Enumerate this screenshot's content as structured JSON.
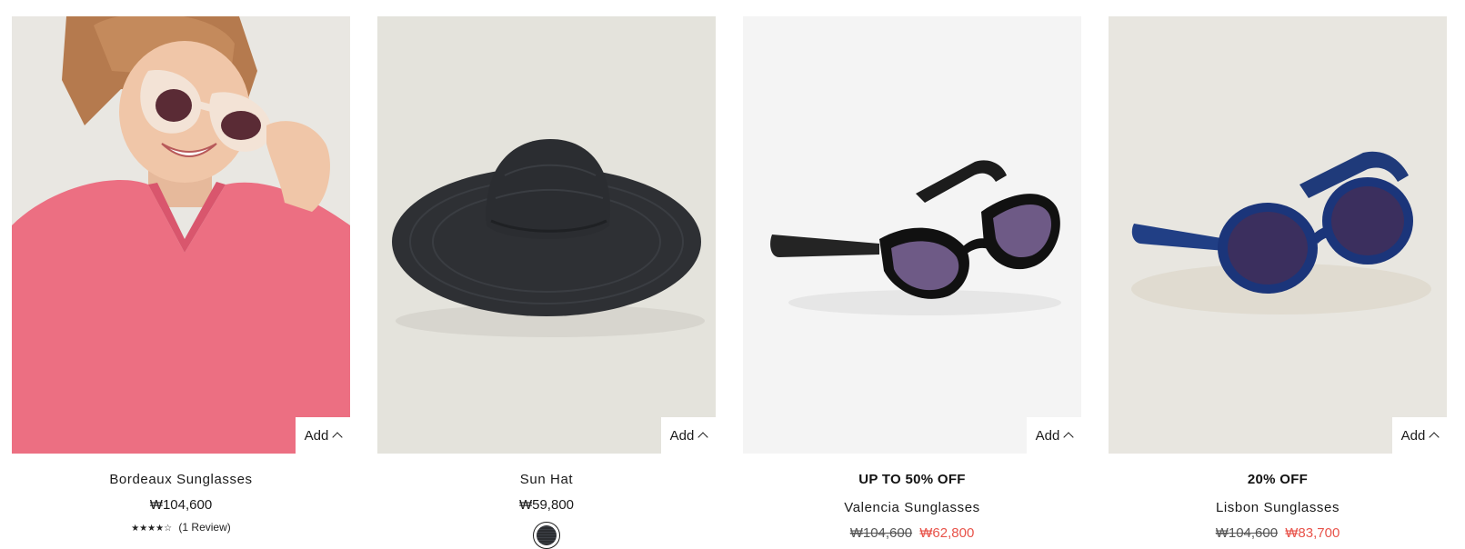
{
  "add_label": "Add",
  "colors": {
    "sale": "#e8534a",
    "text": "#1a1a1a"
  },
  "products": [
    {
      "name": "Bordeaux Sunglasses",
      "price": "₩104,600",
      "rating_stars": "★★★★☆",
      "rating": 4,
      "reviews": "(1 Review)",
      "image": "woman-wearing-cream-sunglasses-pink-tshirt"
    },
    {
      "name": "Sun Hat",
      "price": "₩59,800",
      "swatch_color": "black",
      "image": "black-straw-sun-hat"
    },
    {
      "badge": "UP TO 50% OFF",
      "name": "Valencia Sunglasses",
      "old_price": "₩104,600",
      "sale_price": "₩62,800",
      "image": "black-cat-eye-sunglasses"
    },
    {
      "badge": "20% OFF",
      "name": "Lisbon Sunglasses",
      "old_price": "₩104,600",
      "sale_price": "₩83,700",
      "image": "blue-round-sunglasses"
    }
  ]
}
